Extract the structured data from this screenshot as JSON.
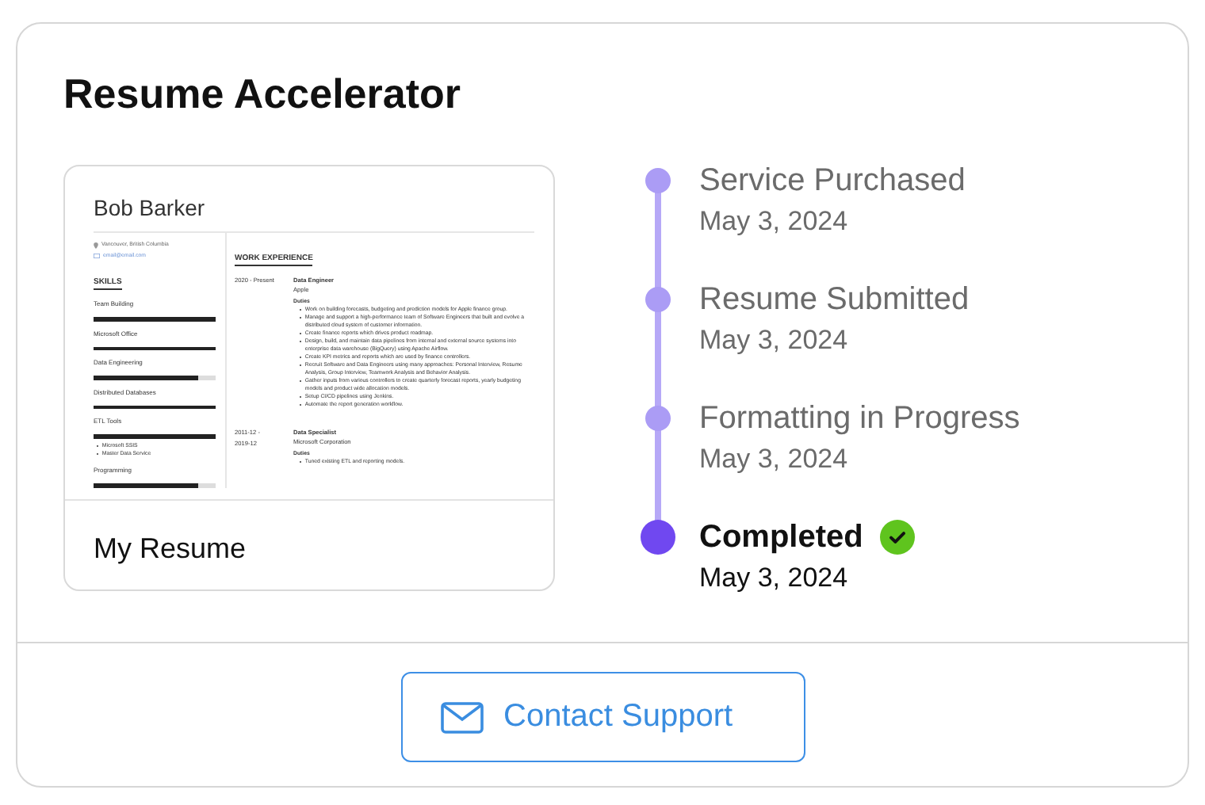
{
  "title": "Resume Accelerator",
  "resume": {
    "name": "Bob Barker",
    "contacts": [
      {
        "kind": "location",
        "text": "Vancouver, British Columbia"
      },
      {
        "kind": "email",
        "text": "email@email.com"
      }
    ],
    "skills_heading": "SKILLS",
    "skills": [
      {
        "name": "Team Building",
        "level": 1
      },
      {
        "name": "Microsoft Office",
        "level": 1
      },
      {
        "name": "Data Engineering",
        "level": 0.86
      },
      {
        "name": "Distributed Databases",
        "level": 1
      },
      {
        "name": "ETL Tools",
        "level": 1,
        "items": [
          "Microsoft SSIS",
          "Master Data Service"
        ]
      },
      {
        "name": "Programming",
        "level": 0.86
      }
    ],
    "experience_heading": "WORK EXPERIENCE",
    "jobs": [
      {
        "dates": [
          "2020 - Present"
        ],
        "title": "Data Engineer",
        "company": "Apple",
        "duties_heading": "Duties",
        "duties": [
          "Work on building forecasts, budgeting and prediction models for Apple finance group.",
          "Manage and support a high-performance team of Software Engineers that built and evolve a distributed cloud system of customer information.",
          "Create finance reports which drives product roadmap.",
          "Design, build, and maintain data pipelines from internal and external source systems into enterprise data warehouse (BigQuery) using Apache Airflow.",
          "Create KPI metrics and reports which are used by finance controllers.",
          "Recruit Software and Data Engineers using many approaches: Personal Interview, Resume Analysis, Group Interview, Teamwork Analysis and Behavior Analysis.",
          "Gather inputs from various controllers to create quarterly forecast reports, yearly budgeting models and product wide allocation models.",
          "Setup CI/CD pipelines using Jenkins.",
          "Automate the report generation workflow."
        ]
      },
      {
        "dates": [
          "2011-12 -",
          "2019-12"
        ],
        "title": "Data Specialist",
        "company": "Microsoft Corporation",
        "duties_heading": "Duties",
        "duties": [
          "Tuned existing ETL and reporting models."
        ]
      }
    ]
  },
  "caption": "My Resume",
  "timeline": [
    {
      "label": "Service Purchased",
      "date": "May 3, 2024",
      "current": false
    },
    {
      "label": "Resume Submitted",
      "date": "May 3, 2024",
      "current": false
    },
    {
      "label": "Formatting in Progress",
      "date": "May 3, 2024",
      "current": false
    },
    {
      "label": "Completed",
      "date": "May 3, 2024",
      "current": true
    }
  ],
  "support_button": {
    "label": "Contact Support"
  }
}
